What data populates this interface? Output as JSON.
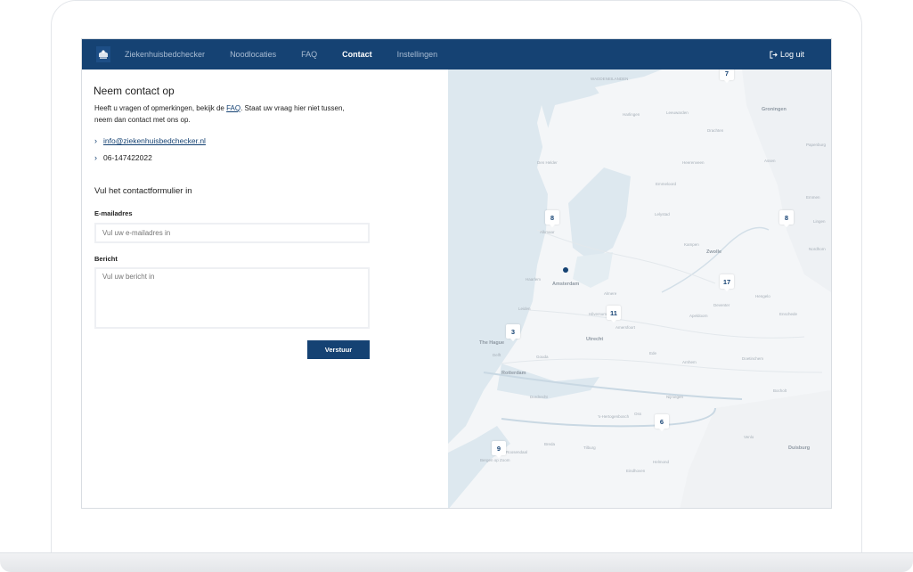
{
  "nav": {
    "brand": "Ziekenhuisbedchecker",
    "items": [
      "Noodlocaties",
      "FAQ",
      "Contact",
      "Instellingen"
    ],
    "active": "Contact",
    "logout": "Log uit"
  },
  "contact": {
    "title": "Neem contact op",
    "intro_before": "Heeft u vragen of opmerkingen, bekijk de ",
    "intro_link": "FAQ",
    "intro_after": ". Staat uw vraag hier niet tussen, neem dan contact met ons op.",
    "email": "info@ziekenhuisbedchecker.nl",
    "phone": "06-147422022"
  },
  "form": {
    "title": "Vul het contactformulier in",
    "email_label": "E-mailadres",
    "email_placeholder": "Vul uw e-mailadres in",
    "message_label": "Bericht",
    "message_placeholder": "Vul uw bericht in",
    "submit": "Verstuur"
  },
  "map": {
    "markers": [
      {
        "id": "7",
        "label": "7"
      },
      {
        "id": "8a",
        "label": "8"
      },
      {
        "id": "8b",
        "label": "8"
      },
      {
        "id": "17",
        "label": "17"
      },
      {
        "id": "11",
        "label": "11"
      },
      {
        "id": "3",
        "label": "3"
      },
      {
        "id": "6",
        "label": "6"
      },
      {
        "id": "9",
        "label": "9"
      }
    ],
    "cities": [
      "WADDENEILANDEN",
      "Groningen",
      "Leeuwarden",
      "Assen",
      "Emmen",
      "Zwolle",
      "Lelystad",
      "Alkmaar",
      "Amsterdam",
      "Haarlem",
      "Utrecht",
      "Amersfoort",
      "Apeldoorn",
      "Enschede",
      "Arnhem",
      "The Hague",
      "Rotterdam",
      "Dordrecht",
      "Breda",
      "Tilburg",
      "Eindhoven",
      "Nijmegen",
      "Duisburg",
      "Bocholt",
      "Deventer",
      "Hengelo",
      "Den Helder",
      "'s-Hertogenbosch",
      "Almere",
      "Hilversum",
      "Gouda",
      "Leiden",
      "Delft",
      "Venlo",
      "Kampen",
      "Emmeloord",
      "Drachten",
      "Heerenveen",
      "Harlingen",
      "Bergen op Zoom",
      "Roosendaal",
      "Helmond",
      "Oss",
      "Ede",
      "Doetinchem",
      "Nordhorn",
      "Lingen",
      "Papenburg"
    ]
  }
}
